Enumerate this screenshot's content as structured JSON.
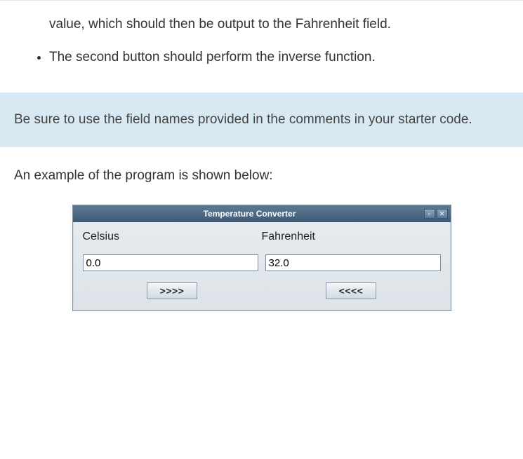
{
  "intro": {
    "line1": "value, which should then be output to the Fahrenheit field.",
    "bullet1": "The second button should perform the inverse function."
  },
  "note": {
    "text": "Be sure to use the field names provided in the comments in your starter code."
  },
  "example_caption": "An example of the program is shown below:",
  "app": {
    "title": "Temperature Converter",
    "celsius_label": "Celsius",
    "fahrenheit_label": "Fahrenheit",
    "celsius_value": "0.0",
    "fahrenheit_value": "32.0",
    "to_f_button": ">>>>",
    "to_c_button": "<<<<",
    "minimize_glyph": "▫",
    "close_glyph": "✕"
  }
}
